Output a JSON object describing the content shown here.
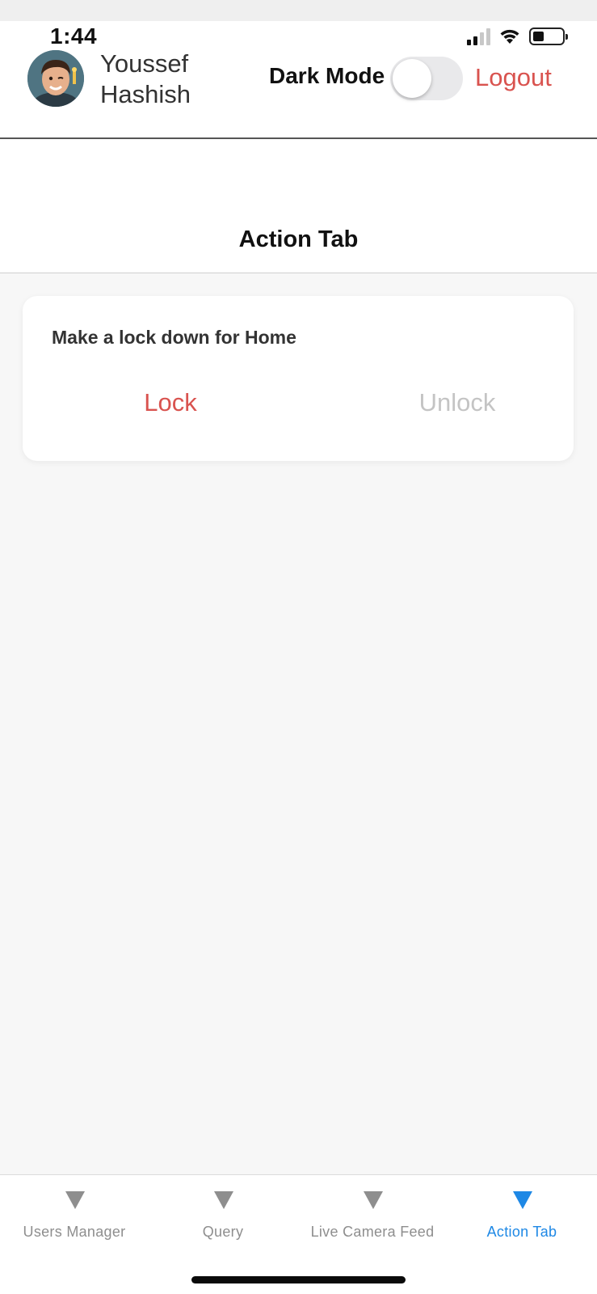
{
  "status_bar": {
    "time": "1:44"
  },
  "header": {
    "user_name": "Youssef Hashish",
    "dark_mode_label": "Dark Mode",
    "dark_mode_on": false,
    "logout_label": "Logout"
  },
  "page": {
    "title": "Action Tab"
  },
  "lock_card": {
    "title": "Make a lock down for Home",
    "lock_label": "Lock",
    "unlock_label": "Unlock"
  },
  "tabs": [
    {
      "label": "Users Manager",
      "icon": "triangle-down-icon",
      "active": false
    },
    {
      "label": "Query",
      "icon": "triangle-down-icon",
      "active": false
    },
    {
      "label": "Live Camera Feed",
      "icon": "triangle-down-icon",
      "active": false
    },
    {
      "label": "Action Tab",
      "icon": "triangle-down-icon",
      "active": true
    }
  ],
  "colors": {
    "accent_red": "#d9534f",
    "active_tab_blue": "#1e88e5",
    "inactive_gray": "#8e8e8e",
    "disabled_gray": "#c4c4c4",
    "background": "#f7f7f7"
  }
}
